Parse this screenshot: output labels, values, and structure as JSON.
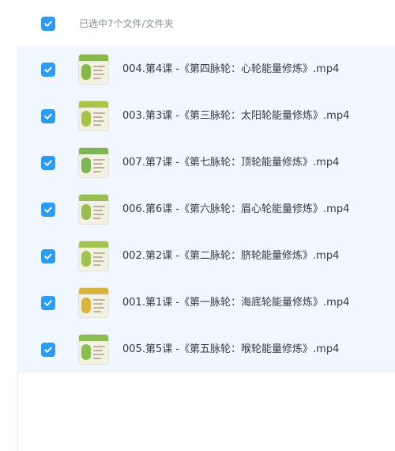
{
  "header": {
    "selection_text": "已选中7个文件/文件夹"
  },
  "files": [
    {
      "name": "004.第4课 -《第四脉轮：心轮能量修炼》.mp4",
      "thumb_accent": "#86b94a"
    },
    {
      "name": "003.第3课 -《第三脉轮：太阳轮能量修炼》.mp4",
      "thumb_accent": "#a6c447"
    },
    {
      "name": "007.第7课 -《第七脉轮：顶轮能量修炼》.mp4",
      "thumb_accent": "#7fb358"
    },
    {
      "name": "006.第6课 -《第六脉轮：眉心轮能量修炼》.mp4",
      "thumb_accent": "#98bd55"
    },
    {
      "name": "002.第2课 -《第二脉轮：脐轮能量修炼》.mp4",
      "thumb_accent": "#a3c351"
    },
    {
      "name": "001.第1课 -《第一脉轮：海底轮能量修炼》.mp4",
      "thumb_accent": "#d8b33f"
    },
    {
      "name": "005.第5课 -《第五脉轮：喉轮能量修炼》.mp4",
      "thumb_accent": "#8cbc54"
    }
  ],
  "colors": {
    "checkbox": "#2d9cf0",
    "list_background": "#f1f7fe",
    "text": "#333a44",
    "muted_text": "#888f99"
  },
  "icons": {
    "checkbox": "check-icon",
    "thumbnail": "video-thumbnail-icon"
  }
}
